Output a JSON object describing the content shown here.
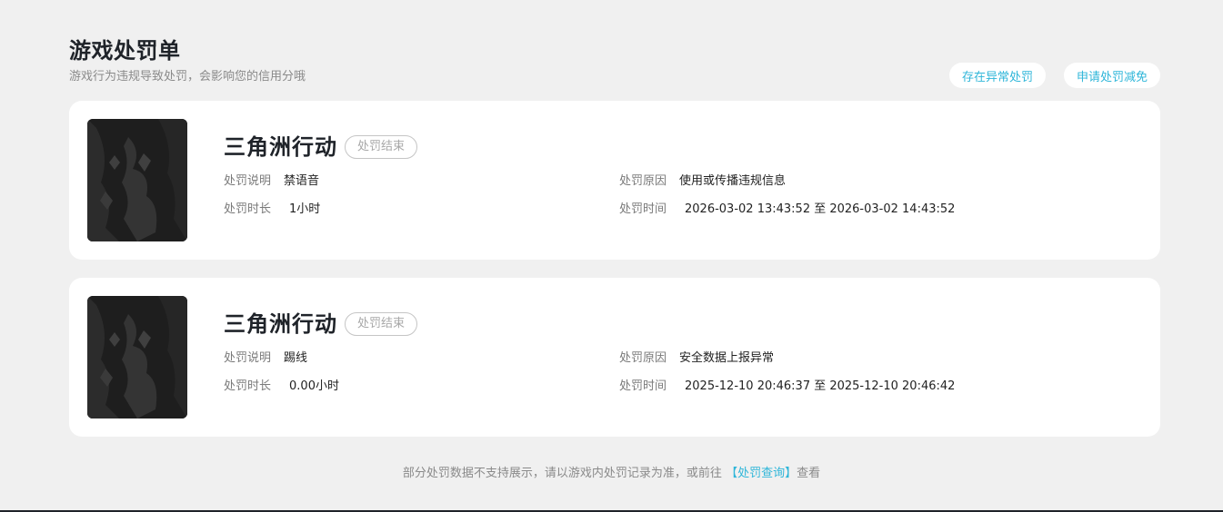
{
  "header": {
    "title": "游戏处罚单",
    "subtitle": "游戏行为违规导致处罚，会影响您的信用分哦"
  },
  "actions": {
    "abnormal_label": "存在异常处罚",
    "appeal_label": "申请处罚减免"
  },
  "records": [
    {
      "game": "三角洲行动",
      "status": "处罚结束",
      "desc_label": "处罚说明",
      "desc": "禁语音",
      "reason_label": "处罚原因",
      "reason": "使用或传播违规信息",
      "duration_label": "处罚时长",
      "duration": "1小时",
      "time_label": "处罚时间",
      "time": "2026-03-02 13:43:52 至 2026-03-02 14:43:52"
    },
    {
      "game": "三角洲行动",
      "status": "处罚结束",
      "desc_label": "处罚说明",
      "desc": "踢线",
      "reason_label": "处罚原因",
      "reason": "安全数据上报异常",
      "duration_label": "处罚时长",
      "duration": "0.00小时",
      "time_label": "处罚时间",
      "time": "2025-12-10 20:46:37 至 2025-12-10 20:46:42"
    }
  ],
  "footer": {
    "prefix": "部分处罚数据不支持展示，请以游戏内处罚记录为准，或前往",
    "link": "【处罚查询】",
    "suffix": "查看"
  },
  "colors": {
    "accent": "#2fb6d9",
    "background": "#f0f0f0",
    "card": "#ffffff"
  }
}
